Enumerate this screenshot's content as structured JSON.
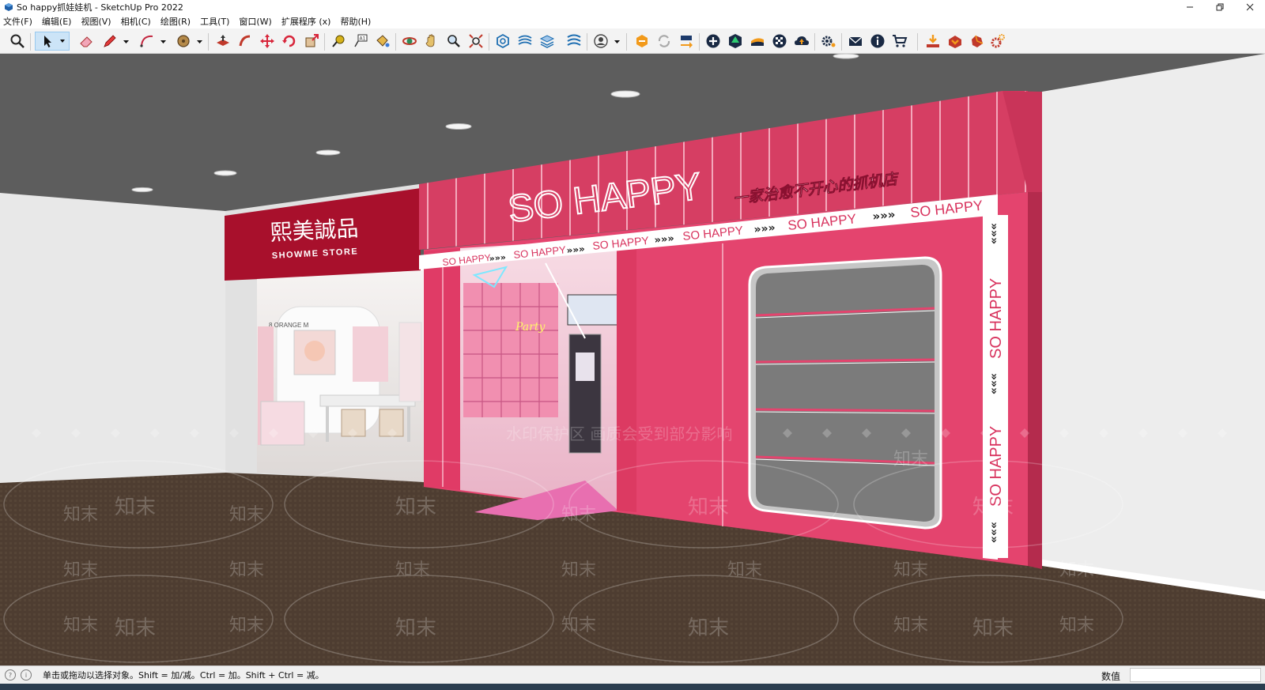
{
  "window": {
    "title": "So happy抓娃娃机 - SketchUp Pro 2022",
    "controls": [
      "minimize",
      "restore",
      "close"
    ]
  },
  "menubar": {
    "items": [
      "文件(F)",
      "编辑(E)",
      "视图(V)",
      "相机(C)",
      "绘图(R)",
      "工具(T)",
      "窗口(W)",
      "扩展程序 (x)",
      "帮助(H)"
    ]
  },
  "toolbar": {
    "tools": [
      "zoom-window",
      "select",
      "eraser",
      "pencil-line",
      "arc",
      "paint-bucket",
      "push-pull",
      "follow-me",
      "move",
      "rotate",
      "scale",
      "tape-measure",
      "text",
      "paint-brush",
      "orbit",
      "pan",
      "zoom",
      "zoom-extents",
      "component",
      "styles",
      "layers",
      "scenes",
      "account",
      "extension-warehouse",
      "refresh",
      "send",
      "add",
      "model-info",
      "sandbox",
      "pattern",
      "cloud-upload",
      "settings",
      "mail",
      "info",
      "cart",
      "download",
      "export",
      "ruby",
      "gear"
    ]
  },
  "scene": {
    "left_sign": {
      "chinese": "熙美誠品",
      "english": "SHOWME STORE"
    },
    "left_shop_logo": "8 ORANGE M",
    "main_sign": {
      "brand": "SO HAPPY",
      "slogan": "一家治愈不开心的抓机店",
      "stripe_text": "SO HAPPY",
      "arrow_glyph": "»»»"
    },
    "inner_neon": "Party",
    "watermark_brand": "知末",
    "watermark_notice": "水印保护区 画质会受到部分影响",
    "colors": {
      "ceiling": "#5d5d5d",
      "wall": "#e9e9e9",
      "floor": "#4d3c30",
      "facade_pink": "#e4446e",
      "facade_pink_dark": "#c93459",
      "sign_red": "#a8102c",
      "stripe": "#ffffff",
      "window_glass": "#7b7b7b"
    }
  },
  "status": {
    "hint": "单击或拖动以选择对象。Shift = 加/减。Ctrl = 加。Shift + Ctrl = 减。",
    "measure_label": "数值",
    "measure_value": ""
  }
}
